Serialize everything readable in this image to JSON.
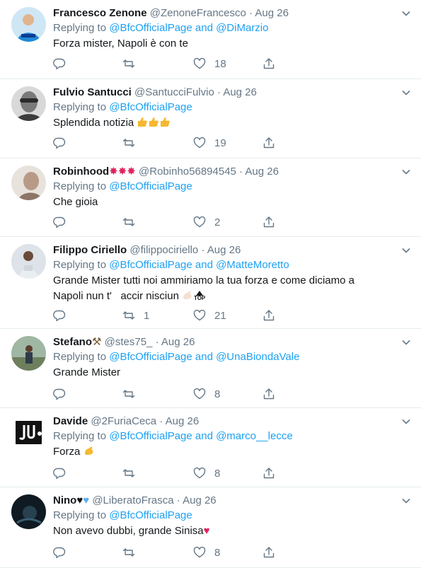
{
  "tweets": [
    {
      "name": "Francesco Zenone",
      "handle": "@ZenoneFrancesco",
      "time": "Aug 26",
      "replying_prefix": "Replying to",
      "replying_to": "@BfcOfficialPage and @DiMarzio",
      "text": "Forza mister, Napoli è con te",
      "reply_count": "",
      "retweet_count": "",
      "like_count": "18",
      "avatar_icon": "avatar-napoli-player"
    },
    {
      "name": "Fulvio Santucci",
      "handle": "@SantucciFulvio",
      "time": "Aug 26",
      "replying_prefix": "Replying to",
      "replying_to": "@BfcOfficialPage",
      "text": "Splendida notizia",
      "reply_count": "",
      "retweet_count": "",
      "like_count": "19",
      "avatar_icon": "avatar-bw-portrait"
    },
    {
      "name": "Robinhood",
      "handle": "@Robinho56894545",
      "time": "Aug 26",
      "replying_prefix": "Replying to",
      "replying_to": "@BfcOfficialPage",
      "text": "Che gioia",
      "reply_count": "",
      "retweet_count": "",
      "like_count": "2",
      "avatar_icon": "avatar-profile-photo"
    },
    {
      "name": "Filippo Ciriello",
      "handle": "@filippociriello",
      "time": "Aug 26",
      "replying_prefix": "Replying to",
      "replying_to": "@BfcOfficialPage and @MatteMoretto",
      "text_line1": "Grande Mister tutti noi ammiriamo la tua forza e come diciamo a",
      "text_line2": "Napoli nun t'   accir nisciun",
      "reply_count": "",
      "retweet_count": "1",
      "like_count": "21",
      "avatar_icon": "avatar-person-photo"
    },
    {
      "name": "Stefano",
      "handle": "@stes75_",
      "time": "Aug 26",
      "replying_prefix": "Replying to",
      "replying_to": "@BfcOfficialPage and @UnaBiondaVale",
      "text": "Grande Mister",
      "reply_count": "",
      "retweet_count": "",
      "like_count": "8",
      "avatar_icon": "avatar-outdoor-photo"
    },
    {
      "name": "Davide",
      "handle": "@2FuriaCeca",
      "time": "Aug 26",
      "replying_prefix": "Replying to",
      "replying_to": "@BfcOfficialPage and @marco__lecce",
      "text": "Forza",
      "reply_count": "",
      "retweet_count": "",
      "like_count": "8",
      "avatar_icon": "avatar-juventus-logo"
    },
    {
      "name": "Nino",
      "handle": "@LiberatoFrasca",
      "time": "Aug 26",
      "replying_prefix": "Replying to",
      "replying_to": "@BfcOfficialPage",
      "text": "Non avevo dubbi, grande Sinisa",
      "reply_count": "",
      "retweet_count": "",
      "like_count": "8",
      "avatar_icon": "avatar-dark-photo"
    }
  ],
  "top_badge": "TOP",
  "colors": {
    "link": "#1da1f2",
    "muted": "#657786",
    "text": "#14171a",
    "divider": "#e6ecf0",
    "heart": "#e0245e"
  }
}
